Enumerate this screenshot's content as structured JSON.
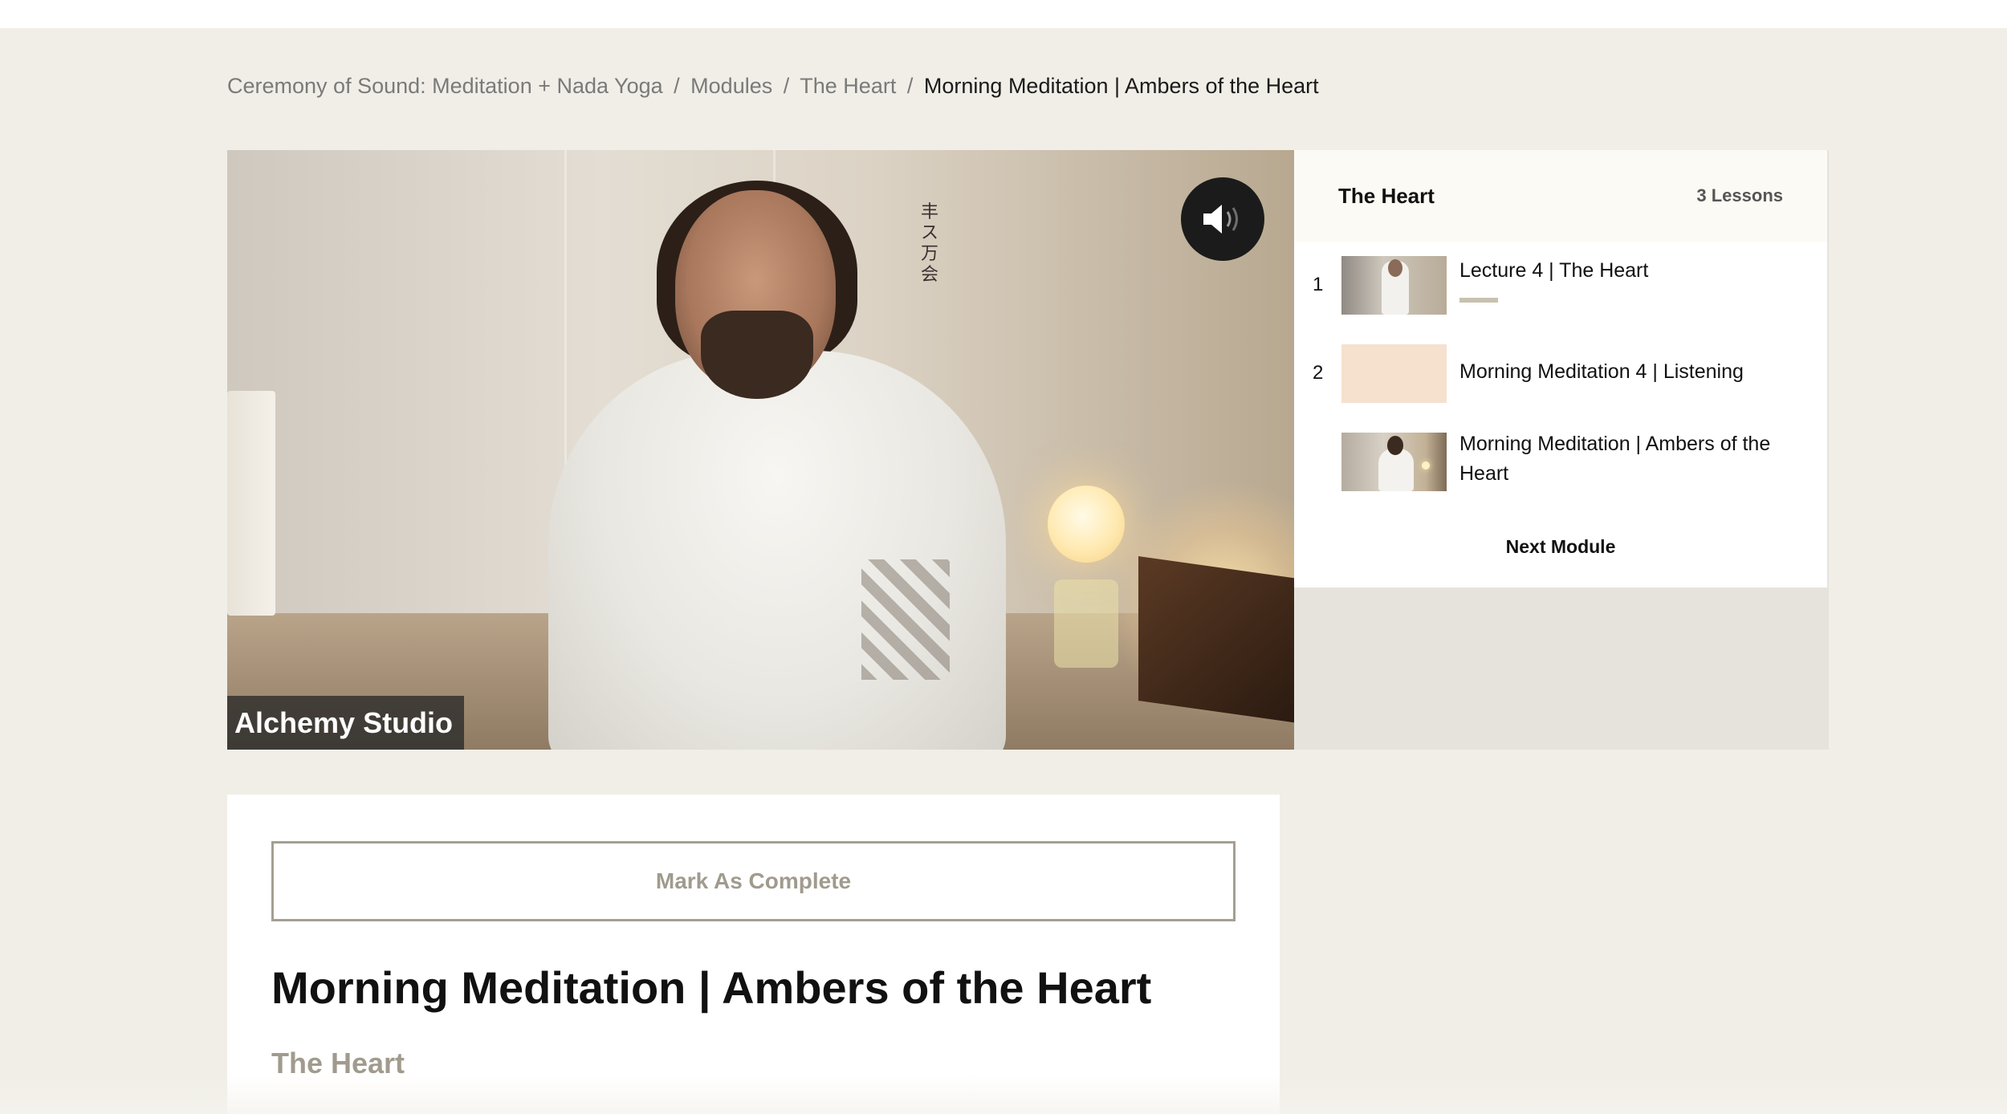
{
  "breadcrumb": {
    "course": "Ceremony of Sound: Meditation + Nada Yoga",
    "modules": "Modules",
    "module": "The Heart",
    "current": "Morning Meditation | Ambers of the Heart",
    "separator": "/"
  },
  "video": {
    "caption": "Alchemy Studio",
    "sound_icon": "speaker-volume-icon",
    "poster_calligraphy": "丰ス万会"
  },
  "sidebar": {
    "module_title": "The Heart",
    "lesson_count": "3 Lessons",
    "lessons": [
      {
        "number": "1",
        "title": "Lecture 4 | The Heart",
        "progress": 0.1
      },
      {
        "number": "2",
        "title": "Morning Meditation 4 | Listening"
      },
      {
        "number": "",
        "title": "Morning Meditation | Ambers of the Heart"
      }
    ],
    "next_module_label": "Next Module"
  },
  "content": {
    "mark_complete_label": "Mark As Complete",
    "lesson_title": "Morning Meditation | Ambers of the Heart",
    "module_name": "The Heart"
  },
  "colors": {
    "page_background": "#f1eee7",
    "accent_muted": "#a09b8d",
    "card_background": "#ffffff",
    "sidebar_header": "#fcfaf4"
  }
}
